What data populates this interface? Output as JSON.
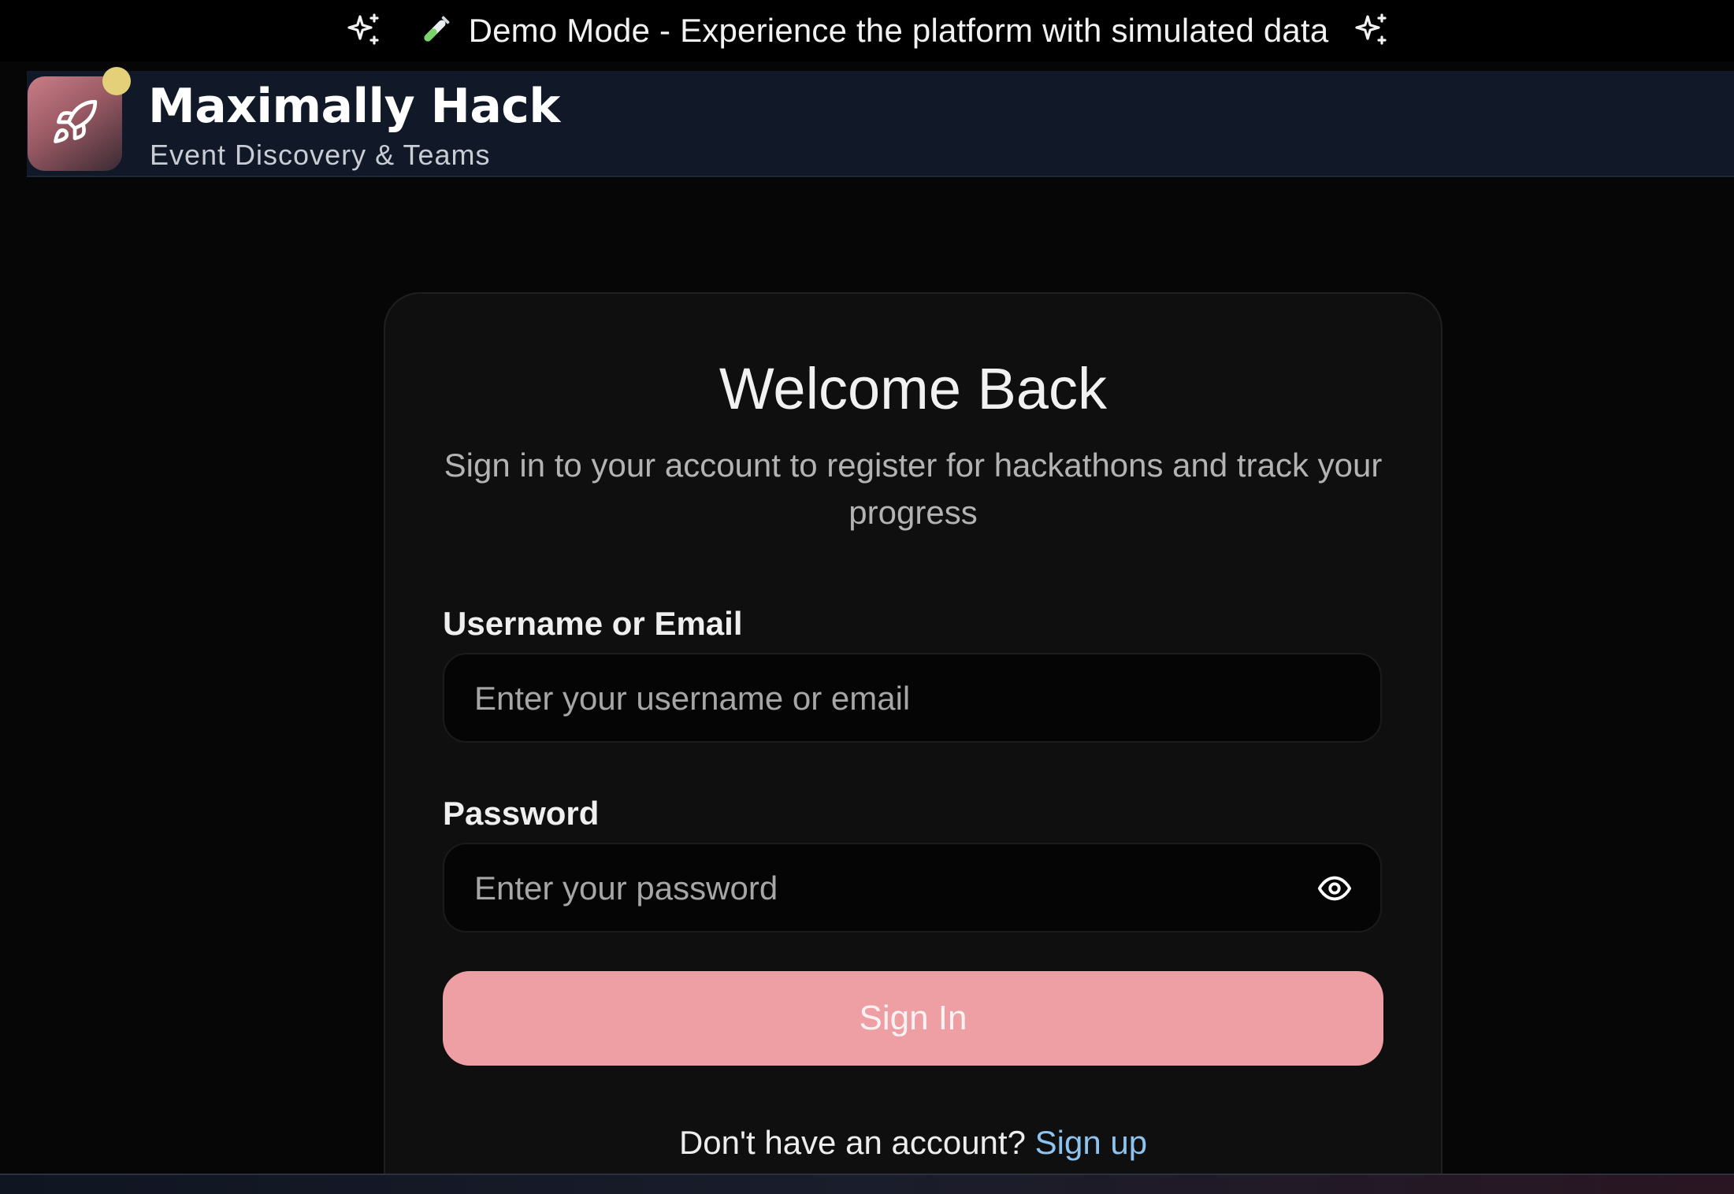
{
  "banner": {
    "emoji": "🧪",
    "text": "Demo Mode - Experience the platform with simulated data"
  },
  "header": {
    "title": "Maximally Hack",
    "subtitle": "Event Discovery & Teams"
  },
  "login": {
    "title": "Welcome Back",
    "subtitle": "Sign in to your account to register for hackathons and track your progress",
    "username_label": "Username or Email",
    "username_placeholder": "Enter your username or email",
    "password_label": "Password",
    "password_placeholder": "Enter your password",
    "submit_label": "Sign In",
    "signup_prompt": "Don't have an account?",
    "signup_link": "Sign up"
  },
  "colors": {
    "accent": "#ee9fa3",
    "link": "#8cc3ef",
    "header_bg": "#111827",
    "notification_dot": "#e5d07a"
  },
  "icons": {
    "banner_left": "sparkles-icon",
    "banner_tube": "test-tube-icon",
    "banner_right": "sparkles-icon",
    "logo": "rocket-icon",
    "password_toggle": "eye-icon"
  }
}
